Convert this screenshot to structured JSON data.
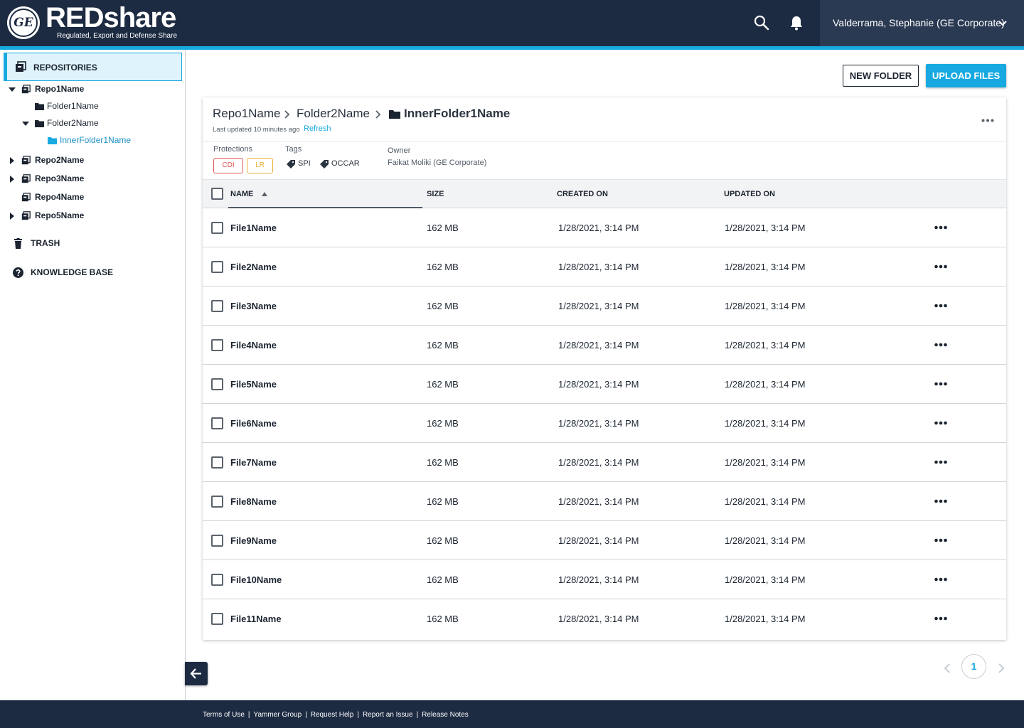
{
  "header": {
    "logo_text": "GE",
    "brand": "REDshare",
    "brand_subtitle": "Regulated, Export and Defense Share",
    "user_name": "Valderrama, Stephanie (GE Corporate)"
  },
  "sidebar": {
    "repositories_label": "REPOSITORIES",
    "tree": {
      "repo1": "Repo1Name",
      "folder1": "Folder1Name",
      "folder2": "Folder2Name",
      "inner_folder": "InnerFolder1Name",
      "repo2": "Repo2Name",
      "repo3": "Repo3Name",
      "repo4": "Repo4Name",
      "repo5": "Repo5Name"
    },
    "trash_label": "TRASH",
    "knowledge_base_label": "KNOWLEDGE BASE"
  },
  "actions": {
    "new_folder": "NEW FOLDER",
    "upload_files": "UPLOAD FILES"
  },
  "breadcrumb": {
    "items": [
      "Repo1Name",
      "Folder2Name"
    ],
    "current": "InnerFolder1Name"
  },
  "status": {
    "last_updated": "Last updated 10 minutes ago",
    "refresh": "Refresh"
  },
  "meta": {
    "protections_label": "Protections",
    "protections": [
      "CDI",
      "LR"
    ],
    "tags_label": "Tags",
    "tags": [
      "SPI",
      "OCCAR"
    ],
    "owner_label": "Owner",
    "owner": "Faikat Moliki (GE Corporate)"
  },
  "table": {
    "columns": {
      "name": "NAME",
      "size": "SIZE",
      "created": "CREATED ON",
      "updated": "UPDATED ON"
    },
    "rows": [
      {
        "name": "File1Name",
        "size": "162 MB",
        "created": "1/28/2021, 3:14 PM",
        "updated": "1/28/2021, 3:14 PM"
      },
      {
        "name": "File2Name",
        "size": "162 MB",
        "created": "1/28/2021, 3:14 PM",
        "updated": "1/28/2021, 3:14 PM"
      },
      {
        "name": "File3Name",
        "size": "162 MB",
        "created": "1/28/2021, 3:14 PM",
        "updated": "1/28/2021, 3:14 PM"
      },
      {
        "name": "File4Name",
        "size": "162 MB",
        "created": "1/28/2021, 3:14 PM",
        "updated": "1/28/2021, 3:14 PM"
      },
      {
        "name": "File5Name",
        "size": "162 MB",
        "created": "1/28/2021, 3:14 PM",
        "updated": "1/28/2021, 3:14 PM"
      },
      {
        "name": "File6Name",
        "size": "162 MB",
        "created": "1/28/2021, 3:14 PM",
        "updated": "1/28/2021, 3:14 PM"
      },
      {
        "name": "File7Name",
        "size": "162 MB",
        "created": "1/28/2021, 3:14 PM",
        "updated": "1/28/2021, 3:14 PM"
      },
      {
        "name": "File8Name",
        "size": "162 MB",
        "created": "1/28/2021, 3:14 PM",
        "updated": "1/28/2021, 3:14 PM"
      },
      {
        "name": "File9Name",
        "size": "162 MB",
        "created": "1/28/2021, 3:14 PM",
        "updated": "1/28/2021, 3:14 PM"
      },
      {
        "name": "File10Name",
        "size": "162 MB",
        "created": "1/28/2021, 3:14 PM",
        "updated": "1/28/2021, 3:14 PM"
      },
      {
        "name": "File11Name",
        "size": "162 MB",
        "created": "1/28/2021, 3:14 PM",
        "updated": "1/28/2021, 3:14 PM"
      }
    ]
  },
  "pagination": {
    "current_page": "1"
  },
  "footer": {
    "links": [
      "Terms of Use",
      "Yammer Group",
      "Request Help",
      "Report an Issue",
      "Release Notes"
    ]
  },
  "icons": {
    "search": "search-icon",
    "notifications": "bell-icon",
    "user_menu": "chevron-down-icon",
    "repository": "repository-icon",
    "folder": "folder-icon",
    "trash": "trash-icon",
    "help": "help-circle-icon",
    "tag": "tag-icon",
    "more": "more-horizontal-icon",
    "collapse": "arrow-left-icon"
  },
  "colors": {
    "header_bg": "#1d2b42",
    "accent": "#17a9df",
    "cdi_badge": "#e25656",
    "lr_badge": "#eab13b",
    "active_tree_item": "#1b8fc4"
  }
}
